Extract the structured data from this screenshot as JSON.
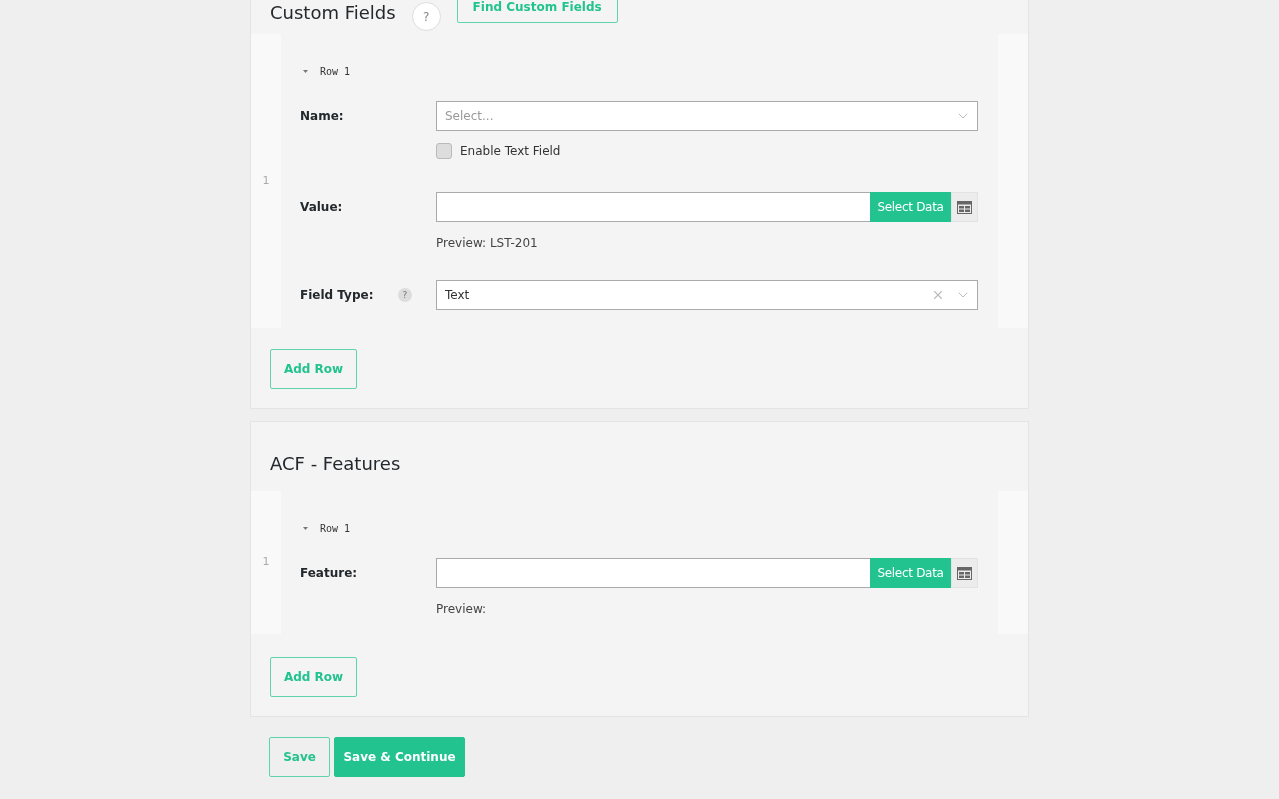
{
  "sections": [
    {
      "title": "Custom Fields",
      "help": "?",
      "action_button": "Find Custom Fields",
      "rows": [
        {
          "index": "1",
          "header": {
            "label": "Row 1",
            "expanded": true
          },
          "fields": [
            {
              "kind": "select",
              "label": "Name:",
              "placeholder": "Select...",
              "checkbox": {
                "label": "Enable Text Field",
                "checked": false
              }
            },
            {
              "kind": "data",
              "label": "Value:",
              "button": "Select Data",
              "preview": "Preview: LST-201"
            },
            {
              "kind": "select",
              "label": "Field Type:",
              "help": "?",
              "value": "Text",
              "clearable": true
            }
          ]
        }
      ],
      "add_button": "Add Row"
    },
    {
      "title": "ACF - Features",
      "rows": [
        {
          "index": "1",
          "header": {
            "label": "Row 1",
            "expanded": true
          },
          "fields": [
            {
              "kind": "data",
              "label": "Feature:",
              "button": "Select Data",
              "preview": "Preview:"
            }
          ]
        }
      ],
      "add_button": "Add Row"
    }
  ],
  "footer_buttons": [
    {
      "label": "Save",
      "kind": "outline"
    },
    {
      "label": "Save & Continue",
      "kind": "primary"
    }
  ]
}
